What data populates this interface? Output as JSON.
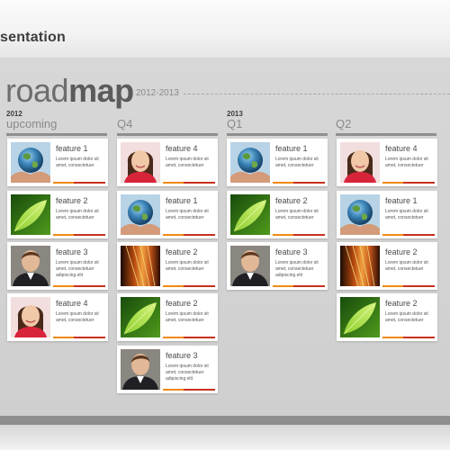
{
  "app": {
    "title": "sentation"
  },
  "slide": {
    "title_light": "road",
    "title_bold": "map",
    "years": "2012-2013"
  },
  "columns": [
    {
      "year": "2012",
      "label": "upcoming"
    },
    {
      "year": "",
      "label": "Q4"
    },
    {
      "year": "2013",
      "label": "Q1"
    },
    {
      "year": "",
      "label": "Q2"
    }
  ],
  "card_text": "Lorem ipsum dolor sit amet, consectetuer",
  "card_text_long": "Lorem ipsum dolor sit amet, consectetuer adipiscing elit",
  "cards": {
    "upcoming": [
      {
        "title": "feature 1",
        "image": "globe-in-hands"
      },
      {
        "title": "feature 2",
        "image": "green-leaf"
      },
      {
        "title": "feature 3",
        "image": "man-portrait"
      },
      {
        "title": "feature 4",
        "image": "girl-portrait"
      }
    ],
    "q4": [
      {
        "title": "feature 4",
        "image": "girl-portrait"
      },
      {
        "title": "feature 1",
        "image": "globe-in-hands"
      },
      {
        "title": "feature 2",
        "image": "guitar-strings"
      },
      {
        "title": "feature 2",
        "image": "green-leaf"
      },
      {
        "title": "feature 3",
        "image": "man-portrait"
      }
    ],
    "q1": [
      {
        "title": "feature 1",
        "image": "globe-in-hands"
      },
      {
        "title": "feature 2",
        "image": "green-leaf"
      },
      {
        "title": "feature 3",
        "image": "man-portrait"
      }
    ],
    "q2": [
      {
        "title": "feature 4",
        "image": "girl-portrait"
      },
      {
        "title": "feature 1",
        "image": "globe-in-hands"
      },
      {
        "title": "feature 2",
        "image": "guitar-strings"
      },
      {
        "title": "feature 2",
        "image": "green-leaf"
      }
    ]
  },
  "colors": {
    "progress_orange": "#f08a12",
    "progress_red": "#c8301f",
    "column_rule": "#8f8f8f"
  }
}
